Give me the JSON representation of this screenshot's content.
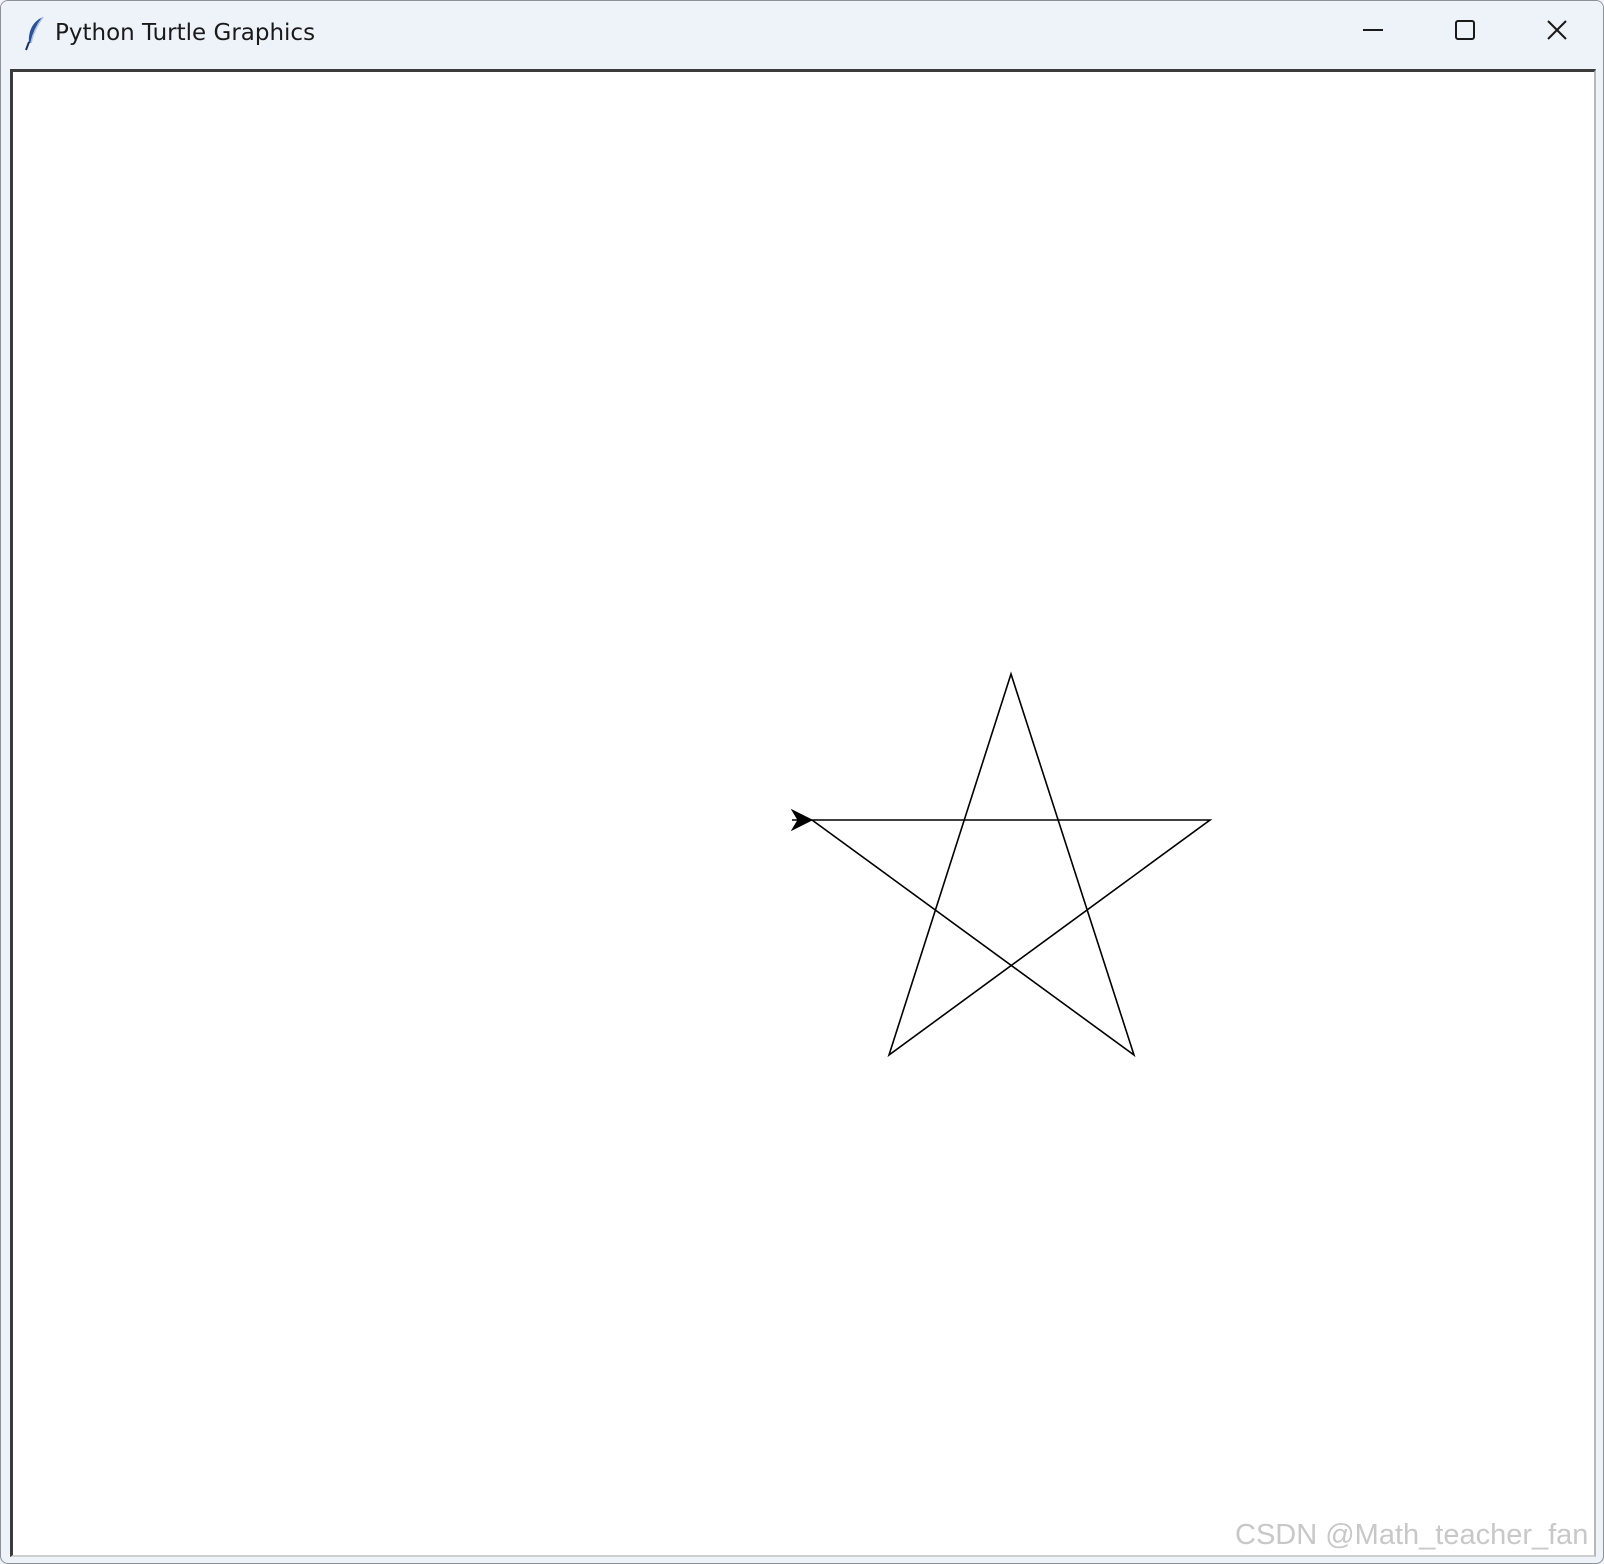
{
  "window": {
    "title": "Python Turtle Graphics",
    "icon": "feather-icon"
  },
  "controls": {
    "minimize_icon": "minimize-icon",
    "maximize_icon": "maximize-icon",
    "close_icon": "close-icon"
  },
  "canvas": {
    "background": "#ffffff",
    "pen_color": "#000000",
    "drawing": "five-pointed star",
    "turtle_shape": "arrow",
    "turtle_heading": "left"
  },
  "watermark": {
    "text": "CSDN @Math_teacher_fan"
  }
}
